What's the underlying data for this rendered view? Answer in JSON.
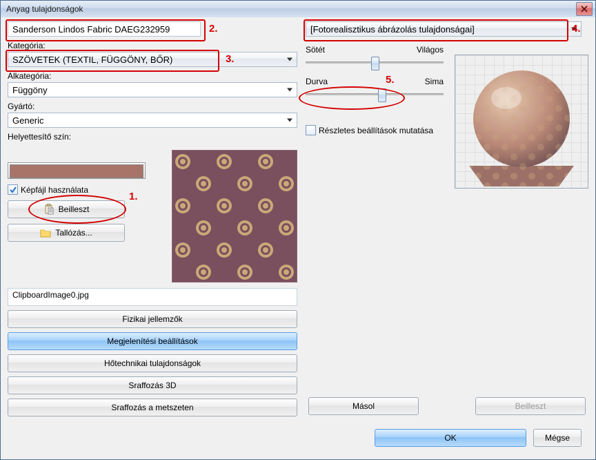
{
  "window": {
    "title": "Anyag tulajdonságok"
  },
  "left": {
    "name_value": "Sanderson Lindos Fabric DAEG232959",
    "category_label": "Kategória:",
    "category_value": "SZÖVETEK (TEXTIL, FÜGGÖNY, BŐR)",
    "subcategory_label": "Alkategória:",
    "subcategory_value": "Függöny",
    "manufacturer_label": "Gyártó:",
    "manufacturer_value": "Generic",
    "repcolor_label": "Helyettesítő szín:",
    "swatch_color": "#a9756b",
    "use_image_label": "Képfájl használata",
    "use_image_checked": true,
    "paste_btn": "Beilleszt",
    "browse_btn": "Tallózás...",
    "filename": "ClipboardImage0.jpg",
    "btn_physical": "Fizikai jellemzők",
    "btn_display": "Megjelenítési beállítások",
    "btn_thermal": "Hőtechnikai tulajdonságok",
    "btn_hatch3d": "Sraffozás 3D",
    "btn_hatchsec": "Sraffozás a metszeten"
  },
  "right": {
    "render_dropdown": "[Fotorealisztikus ábrázolás tulajdonságai]",
    "slider1_left": "Sötét",
    "slider1_right": "Világos",
    "slider1_pos": 0.5,
    "slider2_left": "Durva",
    "slider2_right": "Sima",
    "slider2_pos": 0.55,
    "detail_checkbox": "Részletes beállítások mutatása",
    "detail_checked": false,
    "copy_btn": "Másol",
    "paste_btn": "Beilleszt"
  },
  "footer": {
    "ok": "OK",
    "cancel": "Mégse"
  },
  "annotations": {
    "n1": "1.",
    "n2": "2.",
    "n3": "3.",
    "n4": "4.",
    "n5": "5."
  }
}
